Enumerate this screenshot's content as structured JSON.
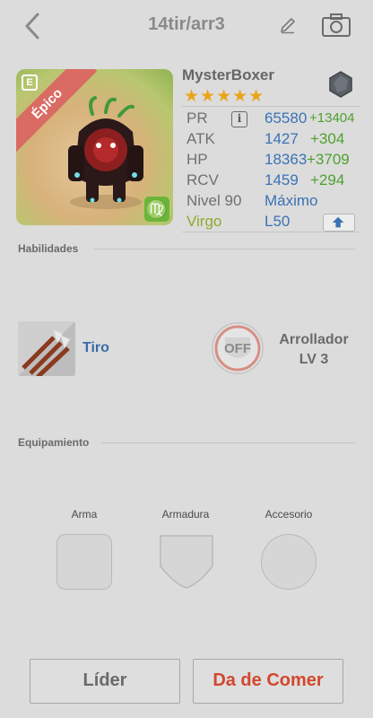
{
  "header": {
    "title": "14tir/arr3"
  },
  "card": {
    "ribbon": "Épico",
    "badge": "E",
    "sign": "♍"
  },
  "monster": {
    "name": "MysterBoxer",
    "stars": "★★★★★",
    "rating": 5,
    "stats": [
      {
        "label": "PR",
        "value": "65580",
        "bonus": "+13404"
      },
      {
        "label": "ATK",
        "value": "1427",
        "bonus": "+304"
      },
      {
        "label": "HP",
        "value": "18363",
        "bonus": "+3709"
      },
      {
        "label": "RCV",
        "value": "1459",
        "bonus": "+294"
      },
      {
        "label": "Nivel 90",
        "value": "Máximo",
        "bonus": ""
      },
      {
        "label": "Virgo",
        "value": "L50",
        "bonus": ""
      }
    ]
  },
  "sections": {
    "skills": "Habilidades",
    "equipment": "Equipamiento"
  },
  "skills": {
    "active_name": "Tiro",
    "leader_icon_text": "OFF",
    "leader_name": "Arrollador",
    "leader_level": "LV 3"
  },
  "equipment": {
    "weapon": "Arma",
    "armor": "Armadura",
    "accessory": "Accesorio"
  },
  "buttons": {
    "leader": "Líder",
    "feed": "Da de Comer"
  },
  "colors": {
    "accent_blue": "#3a72b5",
    "bonus_green": "#4ea12e",
    "feed_red": "#d2472e",
    "ribbon_red": "#d96b63",
    "star_gold": "#e8a51b"
  }
}
